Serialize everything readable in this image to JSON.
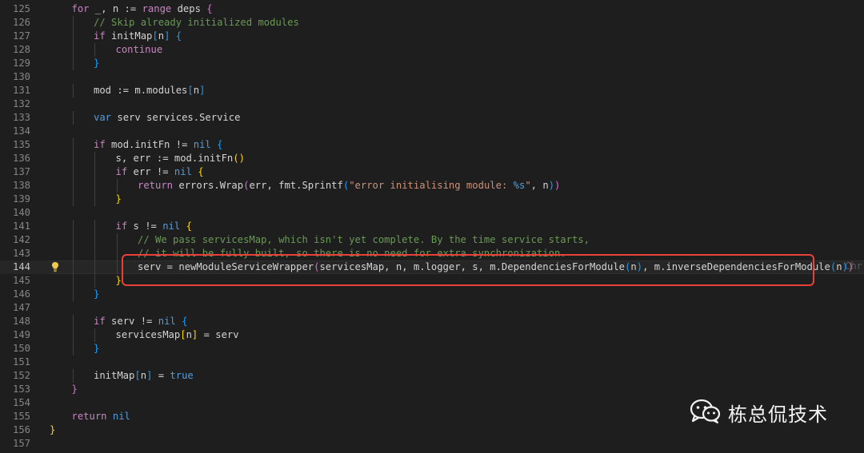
{
  "editor": {
    "lines": [
      {
        "num": "125",
        "tokens": [
          [
            "kw",
            "for"
          ],
          [
            "pl",
            " _, n := "
          ],
          [
            "kw",
            "range"
          ],
          [
            "pl",
            " deps "
          ],
          [
            "b2",
            "{"
          ]
        ]
      },
      {
        "num": "126",
        "tokens": [
          [
            "cm",
            "// Skip already initialized modules"
          ]
        ]
      },
      {
        "num": "127",
        "tokens": [
          [
            "kw",
            "if"
          ],
          [
            "pl",
            " initMap"
          ],
          [
            "b3",
            "["
          ],
          [
            "pl",
            "n"
          ],
          [
            "b3",
            "]"
          ],
          [
            "pl",
            " "
          ],
          [
            "b3",
            "{"
          ]
        ]
      },
      {
        "num": "128",
        "tokens": [
          [
            "kw",
            "continue"
          ]
        ]
      },
      {
        "num": "129",
        "tokens": [
          [
            "b3",
            "}"
          ]
        ]
      },
      {
        "num": "130",
        "tokens": []
      },
      {
        "num": "131",
        "tokens": [
          [
            "pl",
            "mod := m.modules"
          ],
          [
            "b3",
            "["
          ],
          [
            "pl",
            "n"
          ],
          [
            "b3",
            "]"
          ]
        ]
      },
      {
        "num": "132",
        "tokens": []
      },
      {
        "num": "133",
        "tokens": [
          [
            "st",
            "var"
          ],
          [
            "pl",
            " serv services.Service"
          ]
        ]
      },
      {
        "num": "134",
        "tokens": []
      },
      {
        "num": "135",
        "tokens": [
          [
            "kw",
            "if"
          ],
          [
            "pl",
            " mod.initFn != "
          ],
          [
            "st",
            "nil"
          ],
          [
            "pl",
            " "
          ],
          [
            "b3",
            "{"
          ]
        ]
      },
      {
        "num": "136",
        "tokens": [
          [
            "pl",
            "s, err := mod.initFn"
          ],
          [
            "b1",
            "()"
          ]
        ]
      },
      {
        "num": "137",
        "tokens": [
          [
            "kw",
            "if"
          ],
          [
            "pl",
            " err != "
          ],
          [
            "st",
            "nil"
          ],
          [
            "pl",
            " "
          ],
          [
            "b1",
            "{"
          ]
        ]
      },
      {
        "num": "138",
        "tokens": [
          [
            "kw",
            "return"
          ],
          [
            "pl",
            " errors.Wrap"
          ],
          [
            "b2",
            "("
          ],
          [
            "pl",
            "err, fmt.Sprintf"
          ],
          [
            "b3",
            "("
          ],
          [
            "str",
            "\"error initialising module: "
          ],
          [
            "fmt",
            "%s"
          ],
          [
            "str",
            "\""
          ],
          [
            "pl",
            ", n"
          ],
          [
            "b3",
            ")"
          ],
          [
            "b2",
            ")"
          ]
        ]
      },
      {
        "num": "139",
        "tokens": [
          [
            "b1",
            "}"
          ]
        ]
      },
      {
        "num": "140",
        "tokens": []
      },
      {
        "num": "141",
        "tokens": [
          [
            "kw",
            "if"
          ],
          [
            "pl",
            " s != "
          ],
          [
            "st",
            "nil"
          ],
          [
            "pl",
            " "
          ],
          [
            "b1",
            "{"
          ]
        ]
      },
      {
        "num": "142",
        "tokens": [
          [
            "cm",
            "// We pass servicesMap, which isn't yet complete. By the time service starts,"
          ]
        ]
      },
      {
        "num": "143",
        "tokens": [
          [
            "cm",
            "// it will be fully built, so there is no need for extra synchronization."
          ]
        ]
      },
      {
        "num": "144",
        "tokens": [
          [
            "pl",
            "serv = newModuleServiceWrapper"
          ],
          [
            "b2",
            "("
          ],
          [
            "pl",
            "servicesMap, n, m.logger, s, m.DependenciesForModule"
          ],
          [
            "b3",
            "("
          ],
          [
            "pl",
            "n"
          ],
          [
            "b3",
            ")"
          ],
          [
            "pl",
            ", m.inverseDependenciesForModule"
          ],
          [
            "b3",
            "("
          ],
          [
            "pl",
            "n"
          ],
          [
            "b3",
            ")"
          ],
          [
            "b2",
            ")"
          ]
        ]
      },
      {
        "num": "145",
        "tokens": [
          [
            "b1",
            "}"
          ]
        ]
      },
      {
        "num": "146",
        "tokens": [
          [
            "b3",
            "}"
          ]
        ]
      },
      {
        "num": "147",
        "tokens": []
      },
      {
        "num": "148",
        "tokens": [
          [
            "kw",
            "if"
          ],
          [
            "pl",
            " serv != "
          ],
          [
            "st",
            "nil"
          ],
          [
            "pl",
            " "
          ],
          [
            "b3",
            "{"
          ]
        ]
      },
      {
        "num": "149",
        "tokens": [
          [
            "pl",
            "servicesMap"
          ],
          [
            "b1",
            "["
          ],
          [
            "pl",
            "n"
          ],
          [
            "b1",
            "]"
          ],
          [
            "pl",
            " = serv"
          ]
        ]
      },
      {
        "num": "150",
        "tokens": [
          [
            "b3",
            "}"
          ]
        ]
      },
      {
        "num": "151",
        "tokens": []
      },
      {
        "num": "152",
        "tokens": [
          [
            "pl",
            "initMap"
          ],
          [
            "b3",
            "["
          ],
          [
            "pl",
            "n"
          ],
          [
            "b3",
            "]"
          ],
          [
            "pl",
            " = "
          ],
          [
            "st",
            "true"
          ]
        ]
      },
      {
        "num": "153",
        "tokens": [
          [
            "b2",
            "}"
          ]
        ]
      },
      {
        "num": "154",
        "tokens": []
      },
      {
        "num": "155",
        "tokens": [
          [
            "kw",
            "return"
          ],
          [
            "pl",
            " "
          ],
          [
            "st",
            "nil"
          ]
        ]
      },
      {
        "num": "156",
        "tokens": [
          [
            "b1",
            "}"
          ]
        ]
      },
      {
        "num": "157",
        "tokens": []
      }
    ],
    "active_line": "144",
    "ghost_text": "Chr"
  },
  "watermark": {
    "text": "栋总侃技术",
    "icon": "wechat-icon"
  },
  "colors": {
    "background": "#1e1e1e",
    "highlight_box": "#e8413a"
  }
}
